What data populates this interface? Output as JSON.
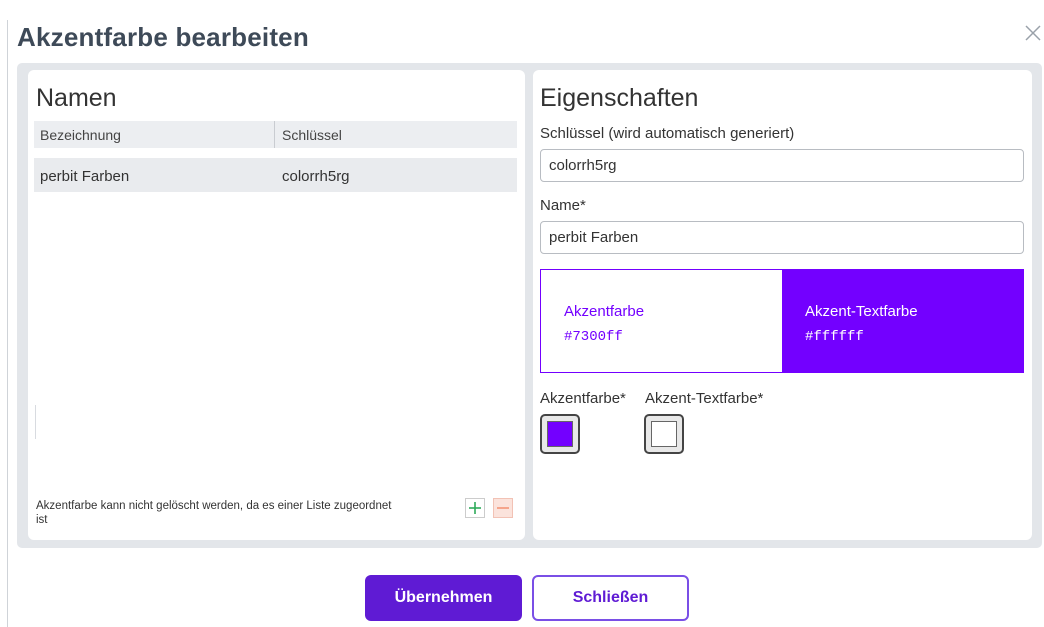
{
  "dialog": {
    "title": "Akzentfarbe bearbeiten",
    "close_icon": "close-icon"
  },
  "names_panel": {
    "title": "Namen",
    "columns": [
      "Bezeichnung",
      "Schlüssel"
    ],
    "rows": [
      {
        "bezeichnung": "perbit Farben",
        "schluessel": "colorrh5rg"
      }
    ],
    "delete_note": "Akzentfarbe kann nicht gelöscht werden, da es einer Liste zugeordnet ist",
    "add_icon": "plus-icon",
    "remove_icon": "minus-icon"
  },
  "properties_panel": {
    "title": "Eigenschaften",
    "key_label": "Schlüssel (wird automatisch generiert)",
    "key_value": "colorrh5rg",
    "name_label": "Name*",
    "name_value": "perbit Farben",
    "preview": {
      "accent_label": "Akzentfarbe",
      "accent_hex": "#7300ff",
      "text_label": "Akzent-Textfarbe",
      "text_hex": "#ffffff"
    },
    "swatch_accent_label": "Akzentfarbe*",
    "swatch_text_label": "Akzent-Textfarbe*"
  },
  "buttons": {
    "apply": "Übernehmen",
    "close": "Schließen"
  },
  "colors": {
    "accent": "#7300ff",
    "accent_text": "#ffffff",
    "primary_button": "#5f1bd4",
    "add_icon": "#2eaa5a",
    "remove_icon": "#f5a58c"
  }
}
